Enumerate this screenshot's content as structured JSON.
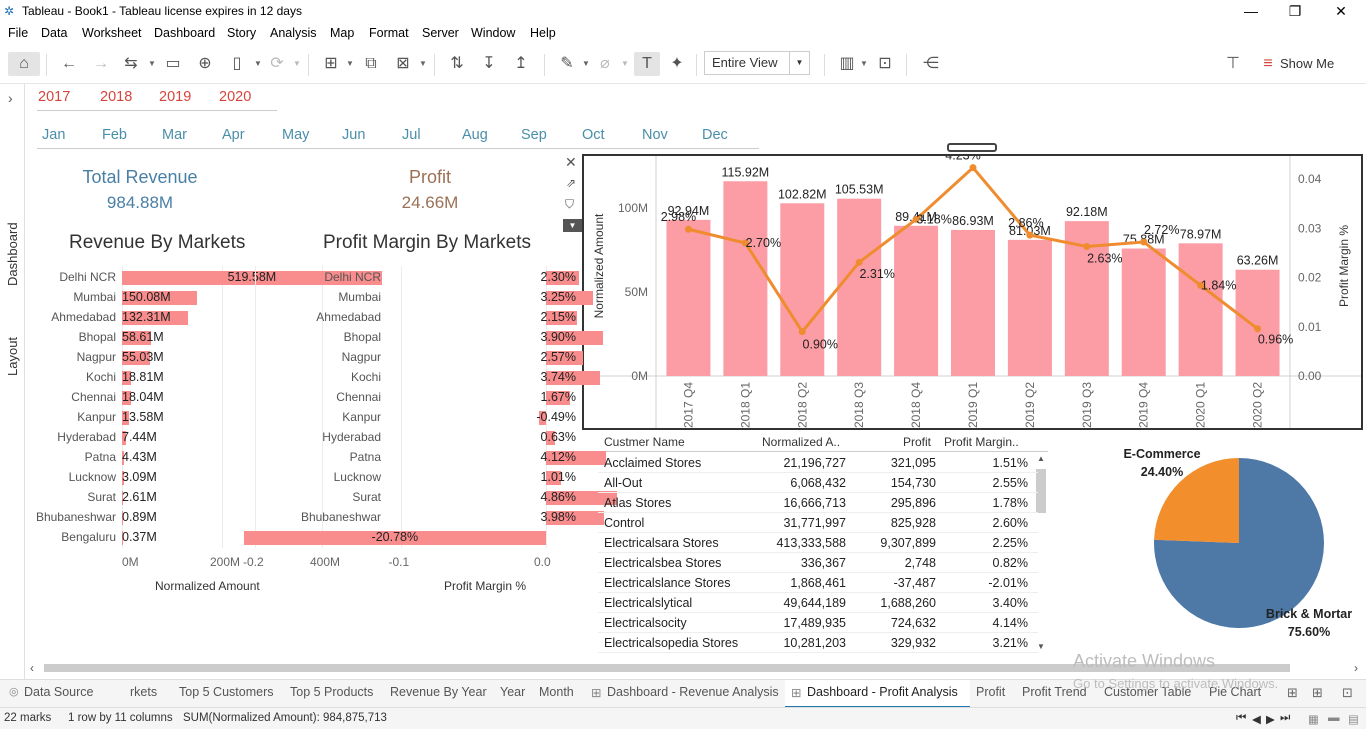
{
  "window": {
    "title": "Tableau - Book1 - Tableau license expires in 12 days",
    "minimize": "—",
    "maximize": "❐",
    "close": "✕"
  },
  "menu": [
    "File",
    "Data",
    "Worksheet",
    "Dashboard",
    "Story",
    "Analysis",
    "Map",
    "Format",
    "Server",
    "Window",
    "Help"
  ],
  "toolbar": {
    "fit_select": "Entire View",
    "show_me": "Show Me"
  },
  "sidebar": {
    "dashboard": "Dashboard",
    "layout": "Layout",
    "expand": "›"
  },
  "years": [
    "2017",
    "2018",
    "2019",
    "2020"
  ],
  "months": [
    "Jan",
    "Feb",
    "Mar",
    "Apr",
    "May",
    "Jun",
    "Jul",
    "Aug",
    "Sep",
    "Oct",
    "Nov",
    "Dec"
  ],
  "kpis": {
    "revenue_label": "Total Revenue",
    "revenue_value": "984.88M",
    "profit_label": "Profit",
    "profit_value": "24.66M"
  },
  "colors": {
    "accent_red": "#d6453d",
    "bar_pink": "#f98c8c",
    "combo_bar": "#fc9ca5",
    "line_orange": "#ef8c2f",
    "pie_blue": "#4e79a7",
    "pie_orange": "#f28e2b",
    "kpi_blue": "#4a7fa5",
    "kpi_brown": "#9c7055"
  },
  "chart_data": [
    {
      "type": "bar",
      "title": "Revenue By Markets",
      "xlabel": "Normalized Amount",
      "categories": [
        "Delhi NCR",
        "Mumbai",
        "Ahmedabad",
        "Bhopal",
        "Nagpur",
        "Kochi",
        "Chennai",
        "Kanpur",
        "Hyderabad",
        "Patna",
        "Lucknow",
        "Surat",
        "Bhubaneshwar",
        "Bengaluru"
      ],
      "values": [
        519.58,
        150.08,
        132.31,
        58.61,
        55.03,
        18.81,
        18.04,
        13.58,
        7.44,
        4.43,
        3.09,
        2.61,
        0.89,
        0.37
      ],
      "labels": [
        "519.58M",
        "150.08M",
        "132.31M",
        "58.61M",
        "55.03M",
        "18.81M",
        "18.04M",
        "13.58M",
        "7.44M",
        "4.43M",
        "3.09M",
        "2.61M",
        "0.89M",
        "0.37M"
      ],
      "ticks": [
        "0M",
        "200M",
        "400M"
      ],
      "xlim": [
        0,
        540
      ]
    },
    {
      "type": "bar",
      "title": "Profit Margin By Markets",
      "xlabel": "Profit Margin %",
      "categories": [
        "Delhi NCR",
        "Mumbai",
        "Ahmedabad",
        "Bhopal",
        "Nagpur",
        "Kochi",
        "Chennai",
        "Kanpur",
        "Hyderabad",
        "Patna",
        "Lucknow",
        "Surat",
        "Bhubaneshwar",
        "Bengaluru"
      ],
      "values": [
        2.3,
        3.25,
        2.15,
        3.9,
        2.57,
        3.74,
        1.67,
        -0.49,
        0.63,
        4.12,
        1.01,
        4.86,
        3.98,
        -20.78
      ],
      "labels": [
        "2.30%",
        "3.25%",
        "2.15%",
        "3.90%",
        "2.57%",
        "3.74%",
        "1.67%",
        "-0.49%",
        "0.63%",
        "4.12%",
        "1.01%",
        "4.86%",
        "3.98%",
        "-20.78%"
      ],
      "ticks": [
        "-0.2",
        "-0.1",
        "0.0"
      ],
      "xlim": [
        -0.21,
        0.05
      ]
    },
    {
      "type": "bar",
      "title": "",
      "ylabel": "Normalized Amount",
      "y2label": "Profit Margin %",
      "categories": [
        "2017 Q4",
        "2018 Q1",
        "2018 Q2",
        "2018 Q3",
        "2018 Q4",
        "2019 Q1",
        "2019 Q2",
        "2019 Q3",
        "2019 Q4",
        "2020 Q1",
        "2020 Q2"
      ],
      "series": [
        {
          "name": "Normalized Amount",
          "values": [
            92.94,
            115.92,
            102.82,
            105.53,
            89.41,
            86.93,
            81.03,
            92.18,
            75.88,
            78.97,
            63.26
          ],
          "labels": [
            "92.94M",
            "115.92M",
            "102.82M",
            "105.53M",
            "89.41M",
            "86.93M",
            "81.03M",
            "92.18M",
            "75.88M",
            "78.97M",
            "63.26M"
          ]
        },
        {
          "name": "Profit Margin %",
          "values": [
            2.98,
            2.7,
            0.9,
            2.31,
            3.18,
            4.23,
            2.86,
            2.63,
            2.72,
            1.84,
            0.96
          ],
          "labels": [
            "2.98%",
            "2.70%",
            "0.90%",
            "2.31%",
            "3.18%",
            "4.23%",
            "2.86%",
            "2.63%",
            "2.72%",
            "1.84%",
            "0.96%"
          ]
        }
      ],
      "yticks": [
        "0M",
        "50M",
        "100M"
      ],
      "ylim": [
        0,
        120
      ],
      "y2ticks": [
        "0.00",
        "0.01",
        "0.02",
        "0.03",
        "0.04"
      ],
      "y2lim": [
        0,
        0.047
      ]
    },
    {
      "type": "table",
      "columns": [
        "Custmer Name",
        "Normalized A..",
        "Profit",
        "Profit Margin.."
      ],
      "rows": [
        [
          "Acclaimed Stores",
          "21,196,727",
          "321,095",
          "1.51%"
        ],
        [
          "All-Out",
          "6,068,432",
          "154,730",
          "2.55%"
        ],
        [
          "Atlas Stores",
          "16,666,713",
          "295,896",
          "1.78%"
        ],
        [
          "Control",
          "31,771,997",
          "825,928",
          "2.60%"
        ],
        [
          "Electricalsara Stores",
          "413,333,588",
          "9,307,899",
          "2.25%"
        ],
        [
          "Electricalsbea Stores",
          "336,367",
          "2,748",
          "0.82%"
        ],
        [
          "Electricalslance Stores",
          "1,868,461",
          "-37,487",
          "-2.01%"
        ],
        [
          "Electricalslytical",
          "49,644,189",
          "1,688,260",
          "3.40%"
        ],
        [
          "Electricalsocity",
          "17,489,935",
          "724,632",
          "4.14%"
        ],
        [
          "Electricalsopedia Stores",
          "10,281,203",
          "329,932",
          "3.21%"
        ]
      ]
    },
    {
      "type": "pie",
      "categories": [
        "E-Commerce",
        "Brick & Mortar"
      ],
      "values": [
        24.4,
        75.6
      ],
      "labels": [
        "24.40%",
        "75.60%"
      ]
    }
  ],
  "tabs": [
    "Data Source",
    "rkets",
    "Top 5 Customers",
    "Top 5 Products",
    "Revenue By Year",
    "Year",
    "Month",
    "Dashboard - Revenue Analysis",
    "Dashboard - Profit Analysis",
    "Profit",
    "Profit Trend",
    "Customer Table",
    "Pie Chart"
  ],
  "status": {
    "marks": "22 marks",
    "rows": "1 row by 11 columns",
    "sum": "SUM(Normalized Amount): 984,875,713"
  },
  "watermark": {
    "line1": "Activate Windows",
    "line2": "Go to Settings to activate Windows."
  }
}
